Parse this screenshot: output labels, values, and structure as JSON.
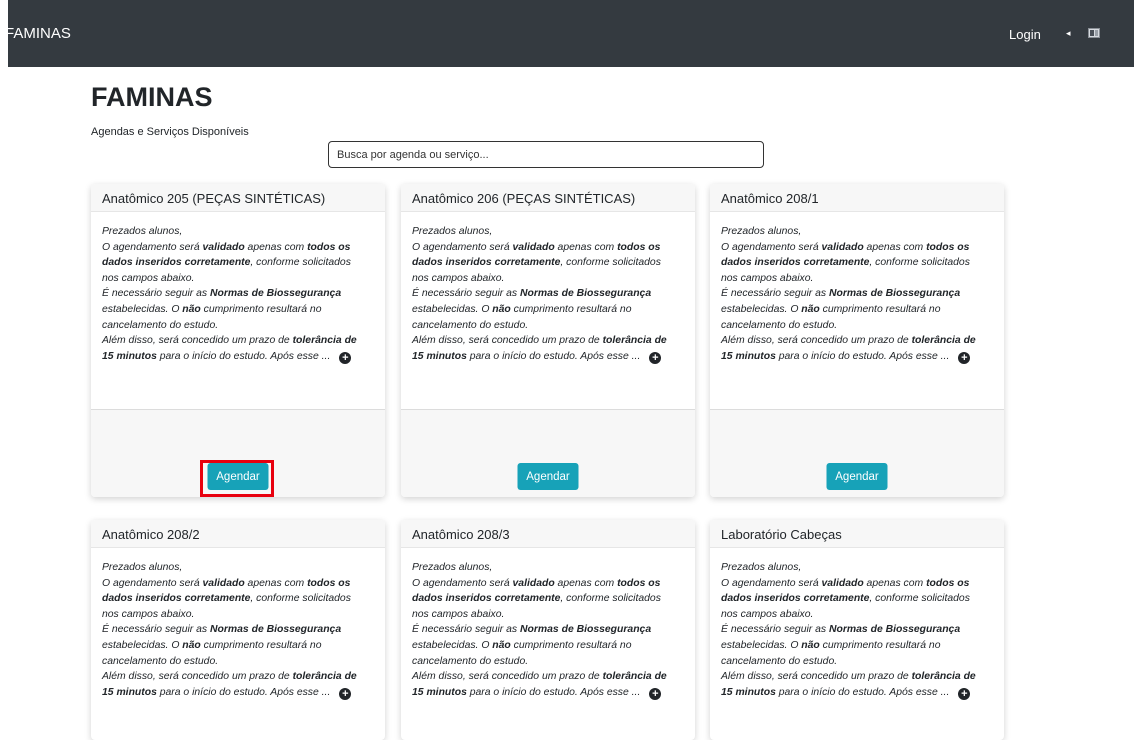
{
  "navbar": {
    "brand": "FAMINAS",
    "login_label": "Login",
    "caret_icon": "◂"
  },
  "page": {
    "title": "FAMINAS",
    "subtitle": "Agendas e Serviços Disponíveis"
  },
  "search": {
    "placeholder": "Busca por agenda ou serviço..."
  },
  "card_text": {
    "l1": "Prezados alunos,",
    "l2a": "O agendamento será ",
    "l2b": "validado",
    "l2c": " apenas com ",
    "l2d": "todos os",
    "l3a": "dados inseridos corretamente",
    "l3b": ", conforme solicitados",
    "l4": "nos campos abaixo.",
    "l5a": "É necessário seguir as ",
    "l5b": "Normas de Biossegurança",
    "l6a": "estabelecidas. O ",
    "l6b": "não",
    "l6c": " cumprimento resultará no",
    "l7": "cancelamento do estudo.",
    "l8a": "Além disso, será concedido um prazo de ",
    "l8b": "tolerância de",
    "l9a": "15 minutos",
    "l9b": " para o início do estudo. Após esse ..."
  },
  "more_icon": "+",
  "cards": [
    {
      "title": "Anatômico 205 (PEÇAS SINTÉTICAS)",
      "button": "Agendar"
    },
    {
      "title": "Anatômico 206 (PEÇAS SINTÉTICAS)",
      "button": "Agendar"
    },
    {
      "title": "Anatômico 208/1",
      "button": "Agendar"
    },
    {
      "title": "Anatômico 208/2"
    },
    {
      "title": "Anatômico 208/3"
    },
    {
      "title": "Laboratório Cabeças"
    }
  ],
  "colors": {
    "navbar": "#343a40",
    "button": "#17a2b8",
    "highlight": "#e8000e"
  }
}
